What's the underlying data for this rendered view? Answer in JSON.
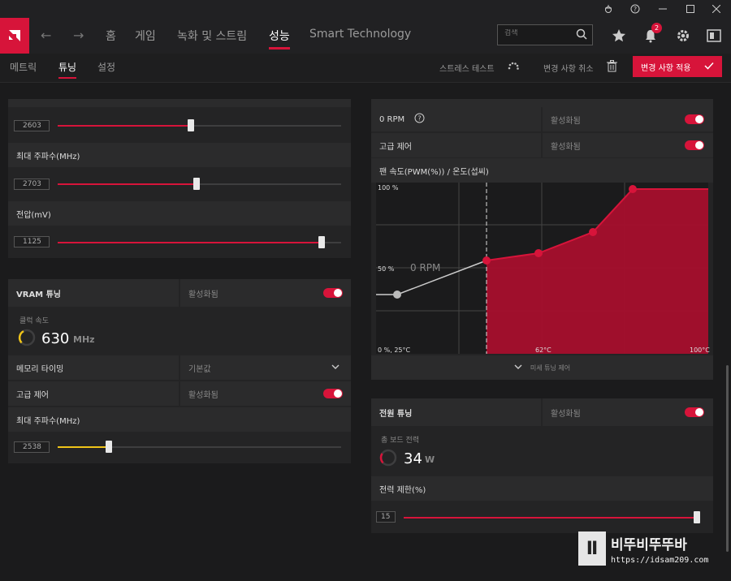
{
  "nav": {
    "home": "홈",
    "games": "게임",
    "record": "녹화 및 스트림",
    "performance": "성능",
    "smart": "Smart Technology",
    "search_placeholder": "검색",
    "notifications": "2"
  },
  "subnav": {
    "metrics": "메트릭",
    "tuning": "튜닝",
    "settings": "설정",
    "stress_test": "스트레스 테스트",
    "discard": "변경 사항 취소",
    "apply": "변경 사항 적용"
  },
  "gpu": {
    "slider1_value": "2603",
    "max_freq_label": "최대 주파수(MHz)",
    "max_freq_value": "2703",
    "voltage_label": "전압(mV)",
    "voltage_value": "1125"
  },
  "vram": {
    "title": "VRAM 튜닝",
    "enabled": "활성화됨",
    "clock_label": "클럭 속도",
    "clock_value": "630",
    "clock_unit": "MHz",
    "mem_timing_label": "메모리 타이밍",
    "mem_timing_value": "기본값",
    "advanced_label": "고급 제어",
    "advanced_value": "활성화됨",
    "max_freq_label": "최대 주파수(MHz)",
    "max_freq_value": "2538"
  },
  "fan": {
    "zero_rpm_label": "0 RPM",
    "zero_rpm_value": "활성화됨",
    "advanced_label": "고급 제어",
    "advanced_value": "활성화됨",
    "curve_title": "팬 속도(PWM(%)) / 온도(섭씨)",
    "y_top": "100 %",
    "y_mid": "50 %",
    "origin": "0 %, 25°C",
    "x_mid": "62°C",
    "x_max": "100°C",
    "zero_rpm_overlay": "0 RPM",
    "fine_tune": "미세 튜닝 제어"
  },
  "power": {
    "title": "전원 튜닝",
    "enabled": "활성화됨",
    "board_power_label": "총 보드 전력",
    "board_power_value": "34",
    "board_power_unit": "W",
    "limit_label": "전력 제한(%)",
    "limit_value": "15"
  },
  "watermark": {
    "brand": "비뚜비뚜뚜바",
    "url": "https://idsam209.com"
  },
  "colors": {
    "accent": "#d7143a",
    "gauge_yellow": "#f0c419"
  },
  "sliders": {
    "gpu_slider1_level": 0.47,
    "gpu_max_freq_level": 0.49,
    "gpu_voltage_level": 0.93,
    "vram_max_freq_level": 0.18,
    "power_limit_level": 1.0
  }
}
